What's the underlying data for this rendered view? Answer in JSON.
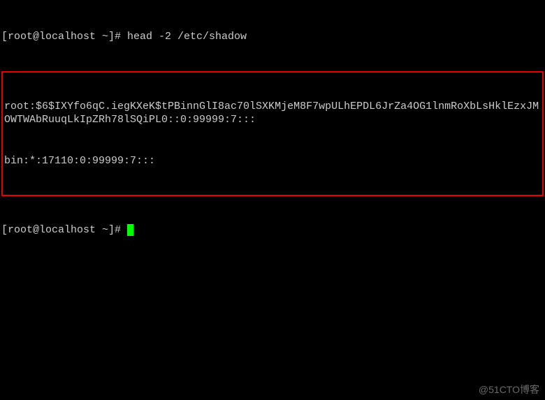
{
  "terminal": {
    "prompt1": "[root@localhost ~]# ",
    "command": "head -2 /etc/shadow",
    "output_line1": "root:$6$IXYfo6qC.iegKXeK$tPBinnGlI8ac70lSXKMjeM8F7wpULhEPDL6JrZa4OG1lnmRoXbLsHklEzxJMOWTWAbRuuqLkIpZRh78lSQiPL0::0:99999:7:::",
    "output_line2": "bin:*:17110:0:99999:7:::",
    "prompt2": "[root@localhost ~]# "
  },
  "watermark": "@51CTO博客"
}
